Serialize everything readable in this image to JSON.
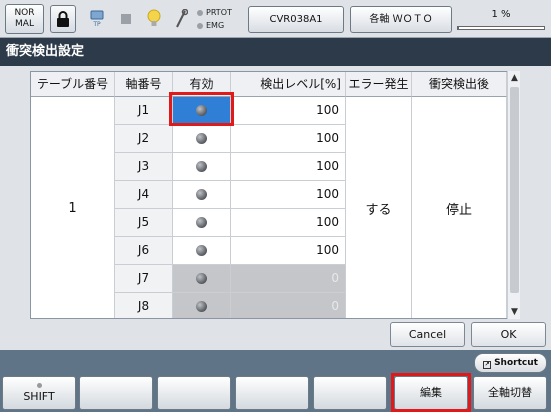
{
  "status": {
    "mode": "NOR\nMAL",
    "tp_label": "TP",
    "prtot_label": "PRTOT",
    "emg_label": "EMG",
    "program": "CVR038A1",
    "axis_mode": "各軸 ＷＯＴＯ",
    "speed_label": "1 %",
    "speed_fraction": 0.01
  },
  "screen_title": "衝突検出設定",
  "table": {
    "headers": [
      "テーブル番号",
      "軸番号",
      "有効",
      "検出レベル[%]",
      "エラー発生",
      "衝突検出後"
    ],
    "table_number": "1",
    "error_output": "する",
    "after_detection": "停止",
    "rows": [
      {
        "axis": "J1",
        "level": "100"
      },
      {
        "axis": "J2",
        "level": "100"
      },
      {
        "axis": "J3",
        "level": "100"
      },
      {
        "axis": "J4",
        "level": "100"
      },
      {
        "axis": "J5",
        "level": "100"
      },
      {
        "axis": "J6",
        "level": "100"
      },
      {
        "axis": "J7",
        "level": "0"
      },
      {
        "axis": "J8",
        "level": "0"
      }
    ]
  },
  "buttons": {
    "cancel": "Cancel",
    "ok": "OK",
    "shortcut": "Shortcut",
    "shift": "SHIFT",
    "edit": "編集",
    "all_axis": "全軸切替"
  },
  "colors": {
    "selected_cell": "#2f7fd6",
    "highlight_box": "#e01a1a",
    "title_bar": "#2c3a4a"
  }
}
